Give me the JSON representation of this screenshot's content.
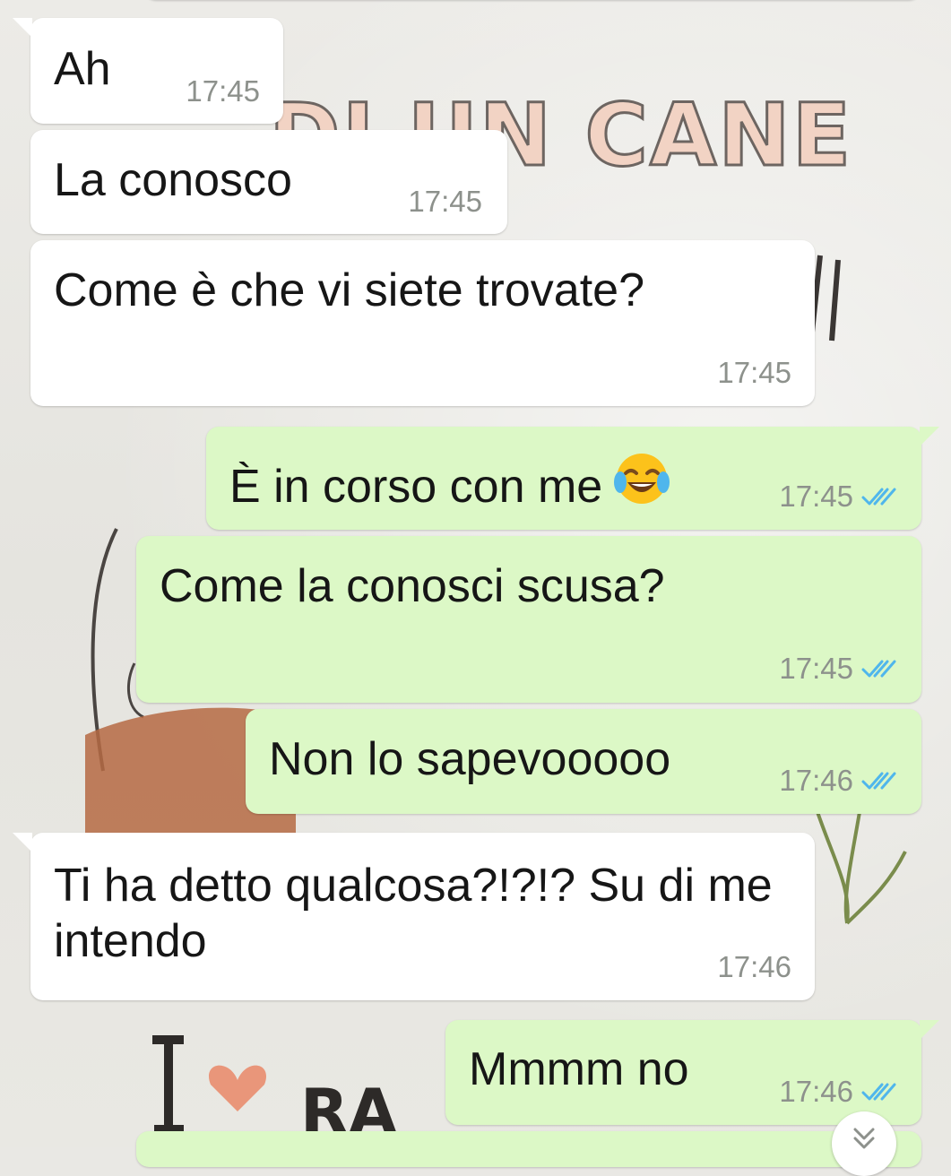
{
  "wallpaper": {
    "headline": "DI UN CANE",
    "bottom_word": "I ♥ RA"
  },
  "messages": [
    {
      "direction": "incoming",
      "text": "Ah",
      "time": "17:45"
    },
    {
      "direction": "incoming",
      "text": "La conosco",
      "time": "17:45"
    },
    {
      "direction": "incoming",
      "text": "Come è che vi siete trovate?",
      "time": "17:45"
    },
    {
      "direction": "outgoing",
      "text": "È in corso con me",
      "emoji": "face-with-tears-of-joy",
      "time": "17:45",
      "status": "read"
    },
    {
      "direction": "outgoing",
      "text": "Come la conosci scusa?",
      "time": "17:45",
      "status": "read"
    },
    {
      "direction": "outgoing",
      "text": "Non lo sapevooooo",
      "time": "17:46",
      "status": "read"
    },
    {
      "direction": "incoming",
      "text": "Ti ha detto qualcosa?!?!? Su di me intendo",
      "time": "17:46"
    },
    {
      "direction": "outgoing",
      "text": "Mmmm no",
      "time": "17:46",
      "status": "read"
    }
  ],
  "colors": {
    "incoming_bubble": "#ffffff",
    "outgoing_bubble": "#dcf8c6",
    "read_ticks": "#4fb6ec",
    "timestamp": "#8d918c"
  },
  "icons": {
    "read_receipt": "double-check-icon",
    "scroll_down": "chevron-down-icon"
  }
}
